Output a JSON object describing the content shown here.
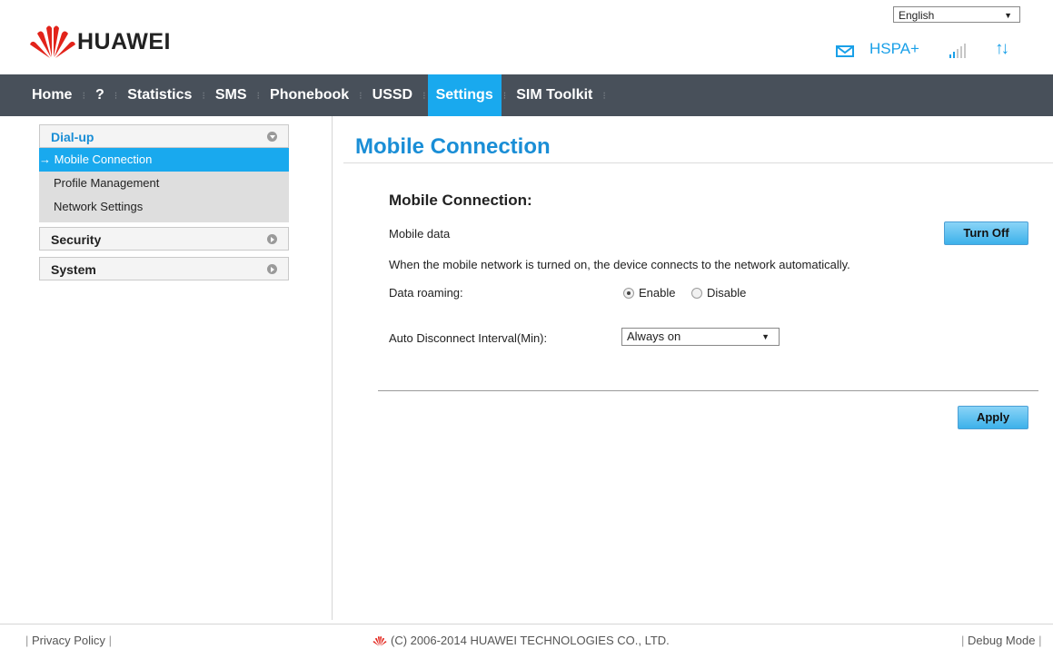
{
  "header": {
    "brand": "HUAWEI",
    "language": "English",
    "network_type": "HSPA+",
    "signal_bars": 5,
    "signal_active": 2,
    "data_arrows": "↑↓",
    "brand_color": "#e2231a",
    "accent_color": "#19a9ee"
  },
  "nav": {
    "items": [
      {
        "label": "Home"
      },
      {
        "label": "?"
      },
      {
        "label": "Statistics"
      },
      {
        "label": "SMS"
      },
      {
        "label": "Phonebook"
      },
      {
        "label": "USSD"
      },
      {
        "label": "Settings"
      },
      {
        "label": "SIM Toolkit"
      }
    ],
    "active_index": 6
  },
  "sidebar": {
    "dialup": {
      "label": "Dial-up",
      "items": [
        {
          "label": "Mobile Connection",
          "active_prefix": "→"
        },
        {
          "label": "Profile Management"
        },
        {
          "label": "Network Settings"
        }
      ]
    },
    "security": {
      "label": "Security"
    },
    "system": {
      "label": "System"
    }
  },
  "main": {
    "page_title": "Mobile Connection",
    "section_title": "Mobile Connection:",
    "mobile_data_label": "Mobile data",
    "turn_off_label": "Turn Off",
    "info_text": "When the mobile network is turned on, the device connects to the network automatically.",
    "roaming_label": "Data roaming:",
    "roaming_enable": "Enable",
    "roaming_disable": "Disable",
    "roaming_selected": "Enable",
    "auto_disconnect_label": "Auto Disconnect Interval(Min):",
    "auto_disconnect_value": "Always on",
    "apply_label": "Apply"
  },
  "footer": {
    "privacy": "Privacy Policy",
    "copyright": "(C) 2006-2014 HUAWEI TECHNOLOGIES CO., LTD.",
    "debug": "Debug Mode"
  }
}
